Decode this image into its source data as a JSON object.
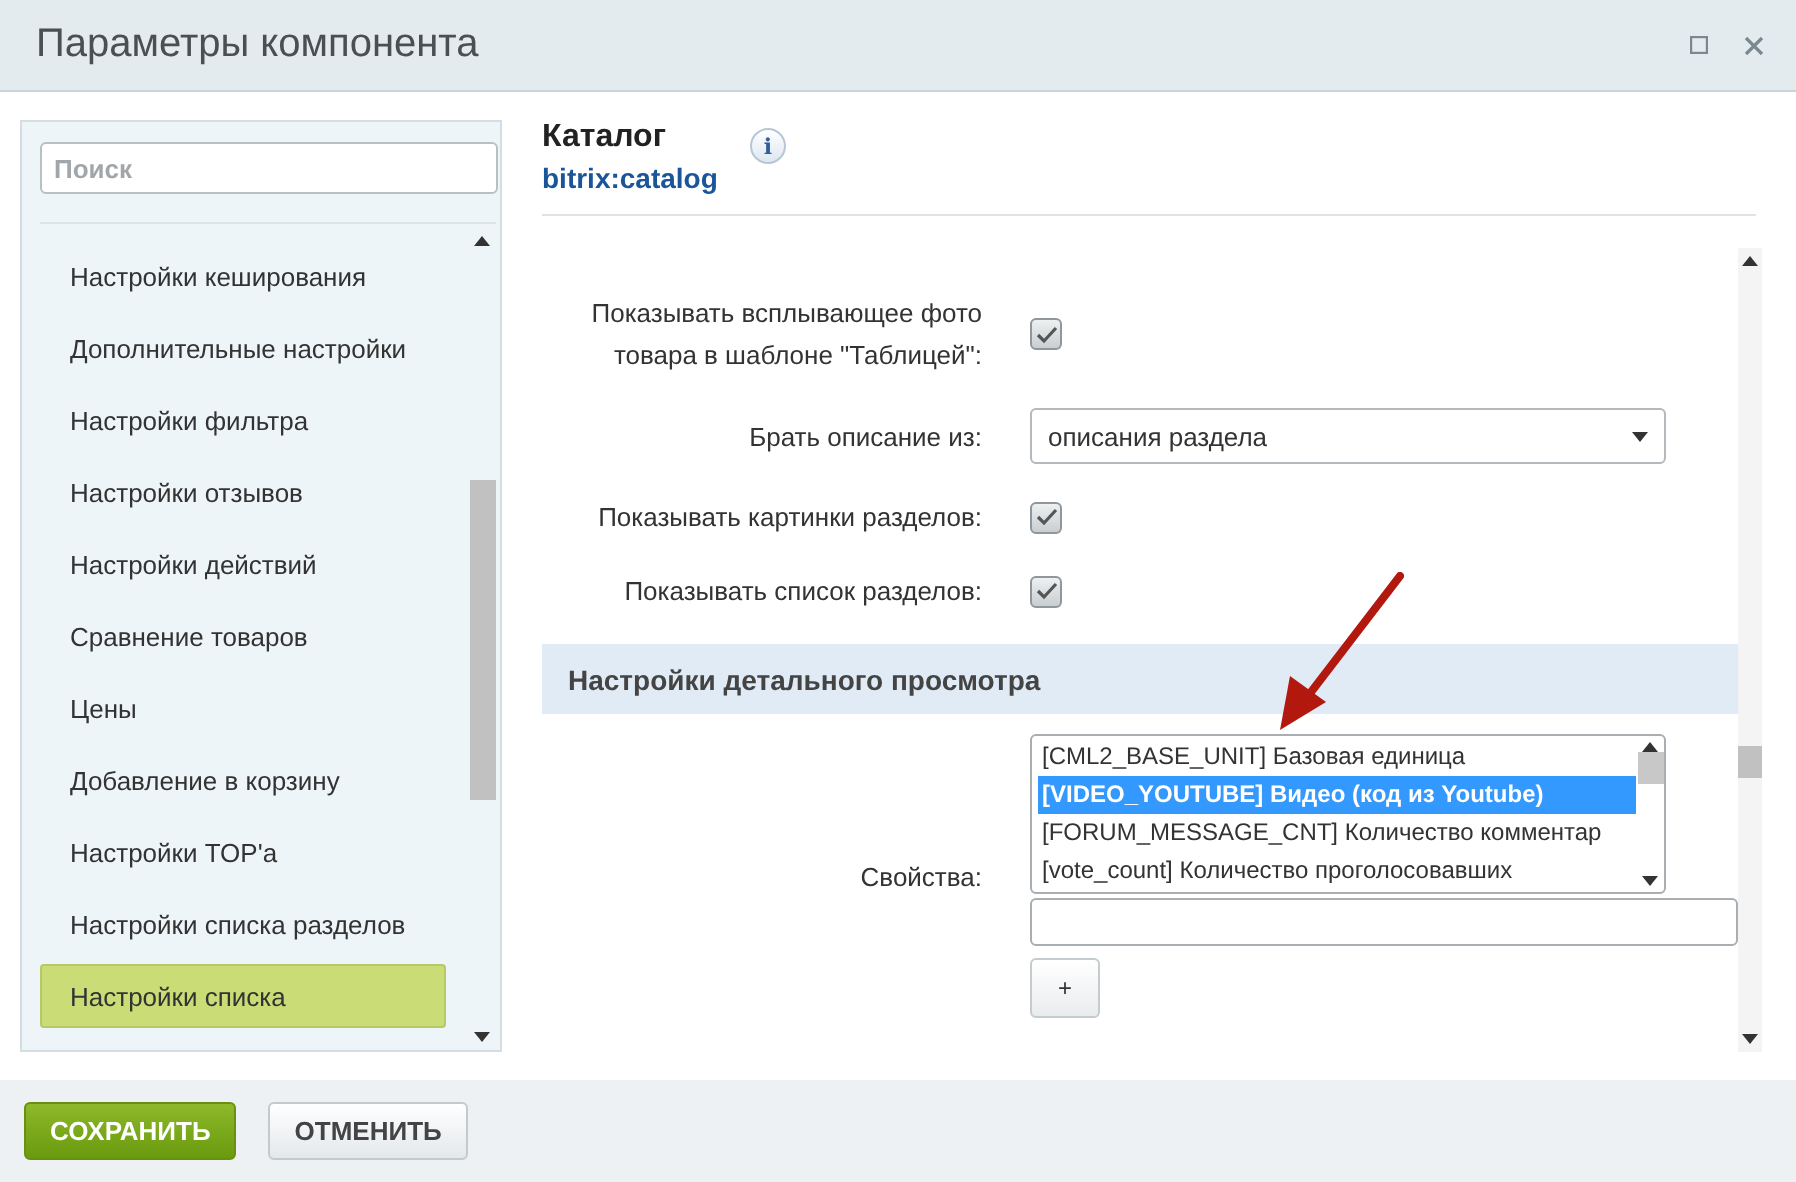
{
  "window": {
    "title": "Параметры компонента"
  },
  "sidebar": {
    "search": {
      "placeholder": "Поиск"
    },
    "items": [
      {
        "label": "Настройки кеширования",
        "selected": false
      },
      {
        "label": "Дополнительные настройки",
        "selected": false
      },
      {
        "label": "Настройки фильтра",
        "selected": false
      },
      {
        "label": "Настройки отзывов",
        "selected": false
      },
      {
        "label": "Настройки действий",
        "selected": false
      },
      {
        "label": "Сравнение товаров",
        "selected": false
      },
      {
        "label": "Цены",
        "selected": false
      },
      {
        "label": "Добавление в корзину",
        "selected": false
      },
      {
        "label": "Настройки TOP'а",
        "selected": false
      },
      {
        "label": "Настройки списка разделов",
        "selected": false
      },
      {
        "label": "Настройки списка",
        "selected": true
      }
    ]
  },
  "component": {
    "title": "Каталог",
    "code": "bitrix:catalog",
    "info_label": "i"
  },
  "settings": [
    {
      "kind": "checkbox",
      "label": "Показывать всплывающее фото товара в шаблоне \"Таблицей\":",
      "checked": true
    },
    {
      "kind": "select",
      "label": "Брать описание из:",
      "value": "описания раздела"
    },
    {
      "kind": "checkbox",
      "label": "Показывать картинки разделов:",
      "checked": true
    },
    {
      "kind": "checkbox",
      "label": "Показывать список разделов:",
      "checked": true
    },
    {
      "kind": "section",
      "label": "Настройки детального просмотра"
    },
    {
      "kind": "multiselect",
      "label": "Свойства:",
      "options": [
        {
          "label": "[CML2_BASE_UNIT] Базовая единица",
          "selected": false
        },
        {
          "label": "[VIDEO_YOUTUBE] Видео (код из Youtube)",
          "selected": true
        },
        {
          "label": "[FORUM_MESSAGE_CNT] Количество комментар",
          "selected": false
        },
        {
          "label": "[vote_count] Количество проголосовавших",
          "selected": false
        }
      ],
      "add_label": "+"
    }
  ],
  "buttons": [
    {
      "kind": "primary",
      "label": "СОХРАНИТЬ"
    },
    {
      "kind": "secondary",
      "label": "ОТМЕНИТЬ"
    }
  ]
}
